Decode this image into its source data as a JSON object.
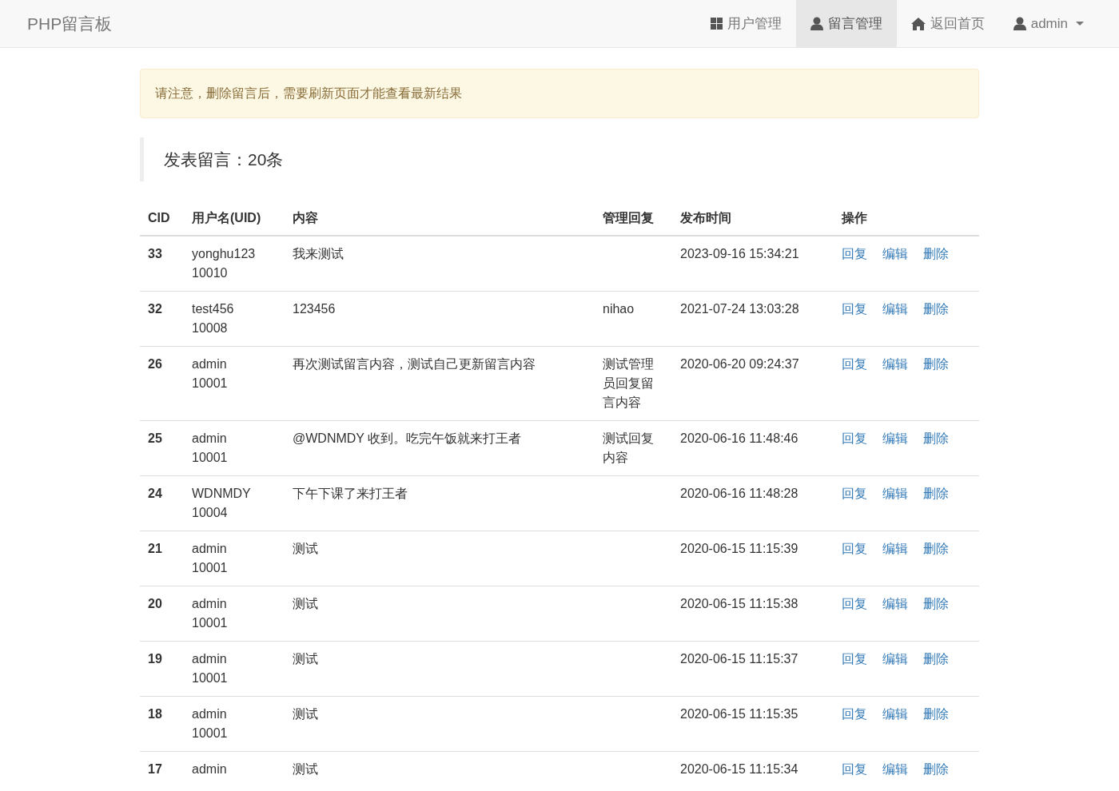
{
  "brand": "PHP留言板",
  "nav": [
    {
      "label": "用户管理",
      "kind": "grid",
      "selected": false
    },
    {
      "label": "留言管理",
      "kind": "user",
      "selected": true
    },
    {
      "label": "返回首页",
      "kind": "home",
      "selected": false
    }
  ],
  "user_menu": {
    "label": "admin"
  },
  "alert": "请注意，删除留言后，需要刷新页面才能查看最新结果",
  "heading": "发表留言：20条",
  "table": {
    "columns": [
      "CID",
      "用户名(UID)",
      "内容",
      "管理回复",
      "发布时间",
      "操作"
    ],
    "rows": [
      {
        "cid": "33",
        "username": "yonghu123",
        "uid": "10010",
        "content": "我来测试",
        "time": "2023-09-16 15:34:21",
        "actions": [
          "回复",
          "编辑",
          "删除"
        ]
      },
      {
        "cid": "32",
        "username": "test456",
        "uid": "10008",
        "content": "123456",
        "reply": "nihao",
        "time": "2021-07-24 13:03:28",
        "actions": [
          "回复",
          "编辑",
          "删除"
        ]
      },
      {
        "cid": "26",
        "username": "admin",
        "uid": "10001",
        "content": "再次测试留言内容，测试自己更新留言内容",
        "reply": "测试管理员回复留言内容",
        "time": "2020-06-20 09:24:37",
        "actions": [
          "回复",
          "编辑",
          "删除"
        ]
      },
      {
        "cid": "25",
        "username": "admin",
        "uid": "10001",
        "content": "@WDNMDY 收到。吃完午饭就来打王者",
        "reply": "测试回复内容",
        "time": "2020-06-16 11:48:46",
        "actions": [
          "回复",
          "编辑",
          "删除"
        ]
      },
      {
        "cid": "24",
        "username": "WDNMDY",
        "uid": "10004",
        "content": "下午下课了来打王者",
        "time": "2020-06-16 11:48:28",
        "actions": [
          "回复",
          "编辑",
          "删除"
        ]
      },
      {
        "cid": "21",
        "username": "admin",
        "uid": "10001",
        "content": "测试",
        "time": "2020-06-15 11:15:39",
        "actions": [
          "回复",
          "编辑",
          "删除"
        ]
      },
      {
        "cid": "20",
        "username": "admin",
        "uid": "10001",
        "content": "测试",
        "time": "2020-06-15 11:15:38",
        "actions": [
          "回复",
          "编辑",
          "删除"
        ]
      },
      {
        "cid": "19",
        "username": "admin",
        "uid": "10001",
        "content": "测试",
        "time": "2020-06-15 11:15:37",
        "actions": [
          "回复",
          "编辑",
          "删除"
        ]
      },
      {
        "cid": "18",
        "username": "admin",
        "uid": "10001",
        "content": "测试",
        "time": "2020-06-15 11:15:35",
        "actions": [
          "回复",
          "编辑",
          "删除"
        ]
      },
      {
        "cid": "17",
        "username": "admin",
        "content": "测试",
        "time": "2020-06-15 11:15:34",
        "actions": [
          "回复",
          "编辑",
          "删除"
        ]
      }
    ]
  }
}
